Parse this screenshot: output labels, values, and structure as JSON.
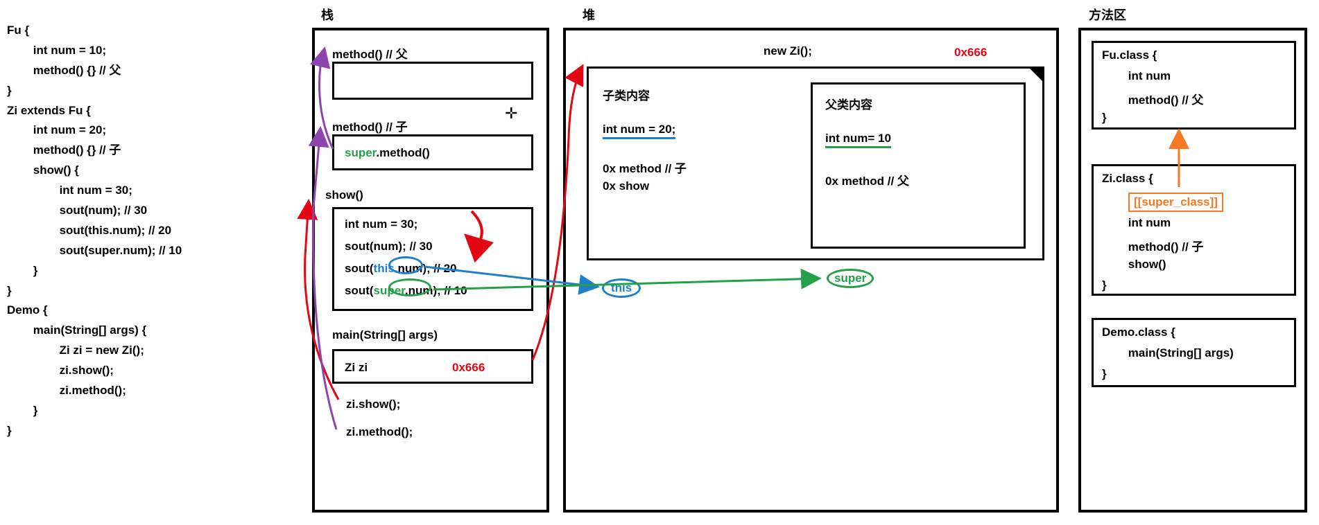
{
  "titles": {
    "stack": "栈",
    "heap": "堆",
    "methodArea": "方法区"
  },
  "code": {
    "l1": "Fu {",
    "l2": "        int num = 10;",
    "l3": "        method() {} // 父",
    "l4": "}",
    "l5": "Zi extends Fu {",
    "l6": "        int num = 20;",
    "l7": "        method() {} // 子",
    "l8": "        show() {",
    "l9": "                int num = 30;",
    "l10": "                sout(num); // 30",
    "l11": "                sout(this.num); // 20",
    "l12": "                sout(super.num); // 10",
    "l13": "        }",
    "l14": "}",
    "l15": "Demo {",
    "l16": "        main(String[] args) {",
    "l17": "                Zi zi = new Zi();",
    "l18": "                zi.show();",
    "l19": "                zi.method();",
    "l20": "        }",
    "l21": "}"
  },
  "stack": {
    "methodFu": "method() // 父",
    "methodZi": "method() // 子",
    "superMethodPre": "super",
    "superMethodPost": ".method()",
    "show": "show()",
    "showL1": "int num = 30;",
    "showL2": "sout(num); // 30",
    "showL3a": "sout(",
    "showL3b": "this",
    "showL3c": ".num); // 20",
    "showL4a": "sout(",
    "showL4b": "super",
    "showL4c": ".num); // 10",
    "main": "main(String[] args)",
    "mainVar": "Zi zi",
    "mainAddr": "0x666",
    "mainCall1": "zi.show();",
    "mainCall2": "zi.method();"
  },
  "heap": {
    "newZi": "new Zi();",
    "addr": "0x666",
    "childTitle": "子类内容",
    "childNum": "int num = 20;",
    "childMethod": "0x method // 子",
    "childShow": "0x show",
    "parentTitle": "父类内容",
    "parentNum": "int num= 10",
    "parentMethod": "0x method // 父",
    "thisLabel": "this",
    "superLabel": "super"
  },
  "methodArea": {
    "fuClass": "Fu.class {",
    "fuNum": "        int num",
    "fuMethod": "        method() // 父",
    "fuClose": "}",
    "ziClass": "Zi.class {",
    "ziSuper": "[[super_class]]",
    "ziNum": "        int num",
    "ziMethod": "        method() // 子",
    "ziShow": "        show()",
    "ziClose": "}",
    "demoClass": "Demo.class {",
    "demoMain": "        main(String[] args)",
    "demoClose": "}"
  }
}
